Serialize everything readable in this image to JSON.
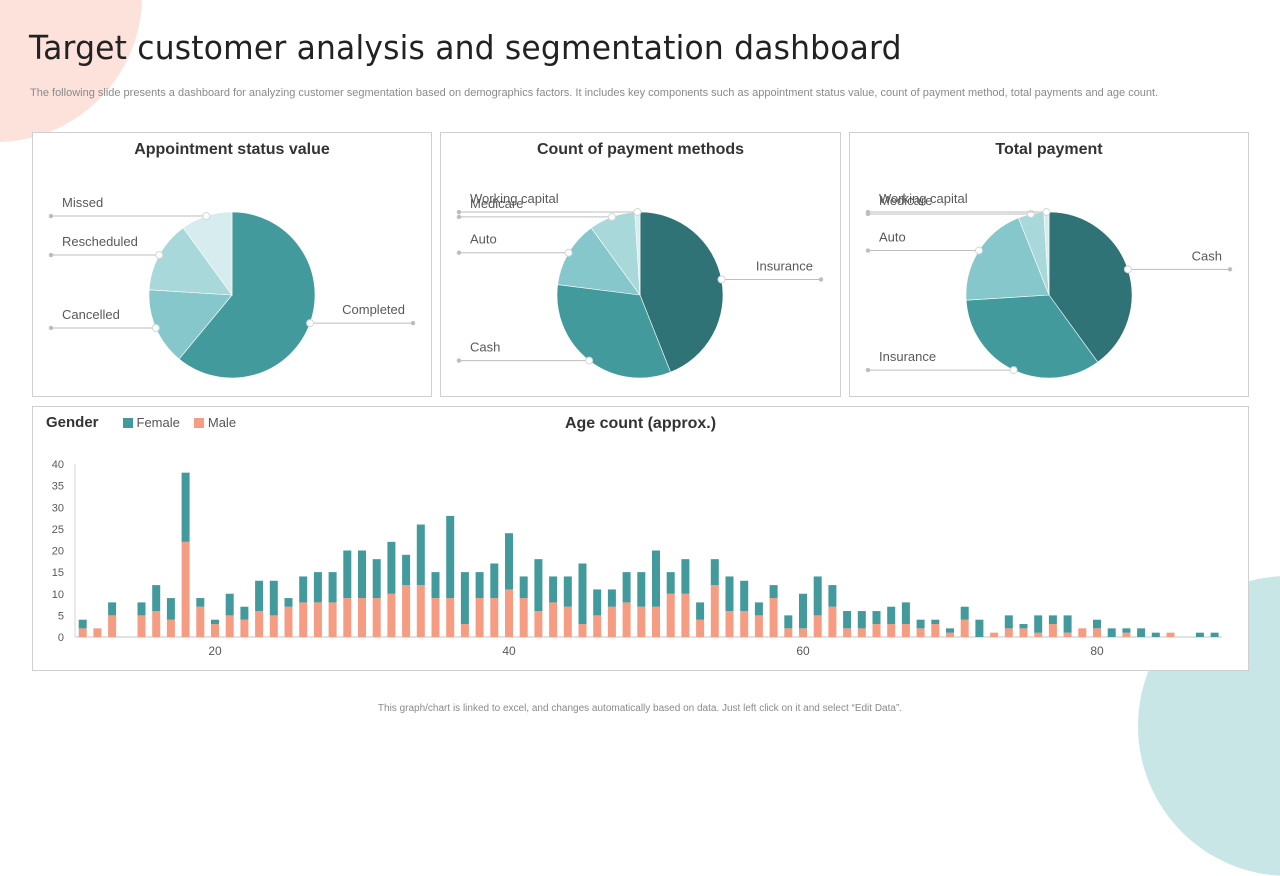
{
  "header": {
    "title": "Target customer analysis and segmentation dashboard",
    "subtitle": "The following slide presents a dashboard for analyzing customer segmentation based on demographics factors. It includes key components such as appointment status value, count of payment method, total payments and age count."
  },
  "footer": "This graph/chart is linked to excel, and changes automatically based on data. Just left click on it and select “Edit Data”.",
  "colors": {
    "female": "#439a9c",
    "male": "#f59c82",
    "dark_teal": "#307377",
    "teal": "#439a9c",
    "mid": "#85c7cb",
    "light": "#a9d8da",
    "pale": "#d6ecee"
  },
  "chart_data": [
    {
      "type": "pie",
      "title": "Appointment status value",
      "slices": [
        {
          "label": "Completed",
          "value": 61,
          "color": "#439a9c"
        },
        {
          "label": "Cancelled",
          "value": 15,
          "color": "#85c7cb"
        },
        {
          "label": "Rescheduled",
          "value": 14,
          "color": "#a9d8da"
        },
        {
          "label": "Missed",
          "value": 10,
          "color": "#d6ecee"
        }
      ]
    },
    {
      "type": "pie",
      "title": "Count of payment methods",
      "slices": [
        {
          "label": "Insurance",
          "value": 44,
          "color": "#307377"
        },
        {
          "label": "Cash",
          "value": 33,
          "color": "#439a9c"
        },
        {
          "label": "Auto",
          "value": 13,
          "color": "#85c7cb"
        },
        {
          "label": "Medicare",
          "value": 9,
          "color": "#a9d8da"
        },
        {
          "label": "Working capital",
          "value": 1,
          "color": "#d6ecee"
        }
      ]
    },
    {
      "type": "pie",
      "title": "Total payment",
      "slices": [
        {
          "label": "Cash",
          "value": 40,
          "color": "#307377"
        },
        {
          "label": "Insurance",
          "value": 34,
          "color": "#439a9c"
        },
        {
          "label": "Auto",
          "value": 20,
          "color": "#85c7cb"
        },
        {
          "label": "Medicare",
          "value": 5,
          "color": "#a9d8da"
        },
        {
          "label": "Working capital",
          "value": 1,
          "color": "#d6ecee"
        }
      ]
    },
    {
      "type": "bar",
      "stacked": true,
      "title": "Age count (approx.)",
      "legend_title": "Gender",
      "legend": [
        "Female",
        "Male"
      ],
      "legend_position": "top-left",
      "xlabel": "",
      "ylabel": "",
      "ylim": [
        0,
        40
      ],
      "yticks": [
        0,
        5,
        10,
        15,
        20,
        25,
        30,
        35,
        40
      ],
      "xticks": [
        20,
        40,
        60,
        80
      ],
      "x": [
        11,
        12,
        13,
        14,
        15,
        16,
        17,
        18,
        19,
        20,
        21,
        22,
        23,
        24,
        25,
        26,
        27,
        28,
        29,
        30,
        31,
        32,
        33,
        34,
        35,
        36,
        37,
        38,
        39,
        40,
        41,
        42,
        43,
        44,
        45,
        46,
        47,
        48,
        49,
        50,
        51,
        52,
        53,
        54,
        55,
        56,
        57,
        58,
        59,
        60,
        61,
        62,
        63,
        64,
        65,
        66,
        67,
        68,
        69,
        70,
        71,
        72,
        73,
        74,
        75,
        76,
        77,
        78,
        79,
        80,
        81,
        82,
        83,
        84,
        85,
        86,
        87,
        88
      ],
      "series": [
        {
          "name": "Male",
          "values": [
            2,
            2,
            5,
            0,
            5,
            6,
            4,
            22,
            7,
            3,
            5,
            4,
            6,
            5,
            7,
            8,
            8,
            8,
            9,
            9,
            9,
            10,
            12,
            12,
            9,
            9,
            3,
            9,
            9,
            11,
            9,
            6,
            8,
            7,
            3,
            5,
            7,
            8,
            7,
            7,
            10,
            10,
            4,
            12,
            6,
            6,
            5,
            9,
            2,
            2,
            5,
            7,
            2,
            2,
            3,
            3,
            3,
            2,
            3,
            1,
            4,
            0,
            1,
            2,
            2,
            1,
            3,
            1,
            2,
            2,
            0,
            1,
            0,
            0,
            1,
            0,
            0,
            0
          ],
          "note": "ages with zero bars omitted from render"
        },
        {
          "name": "Female",
          "values": [
            2,
            0,
            3,
            0,
            3,
            6,
            5,
            16,
            2,
            1,
            5,
            3,
            7,
            8,
            2,
            6,
            7,
            7,
            11,
            11,
            9,
            12,
            7,
            14,
            6,
            19,
            12,
            6,
            8,
            13,
            5,
            12,
            6,
            7,
            14,
            6,
            4,
            7,
            8,
            13,
            5,
            8,
            4,
            6,
            8,
            7,
            3,
            3,
            3,
            8,
            9,
            5,
            4,
            4,
            3,
            4,
            5,
            2,
            1,
            1,
            3,
            4,
            0,
            3,
            1,
            4,
            2,
            4,
            0,
            2,
            2,
            1,
            2,
            1,
            0,
            0,
            1,
            1
          ]
        }
      ]
    }
  ]
}
